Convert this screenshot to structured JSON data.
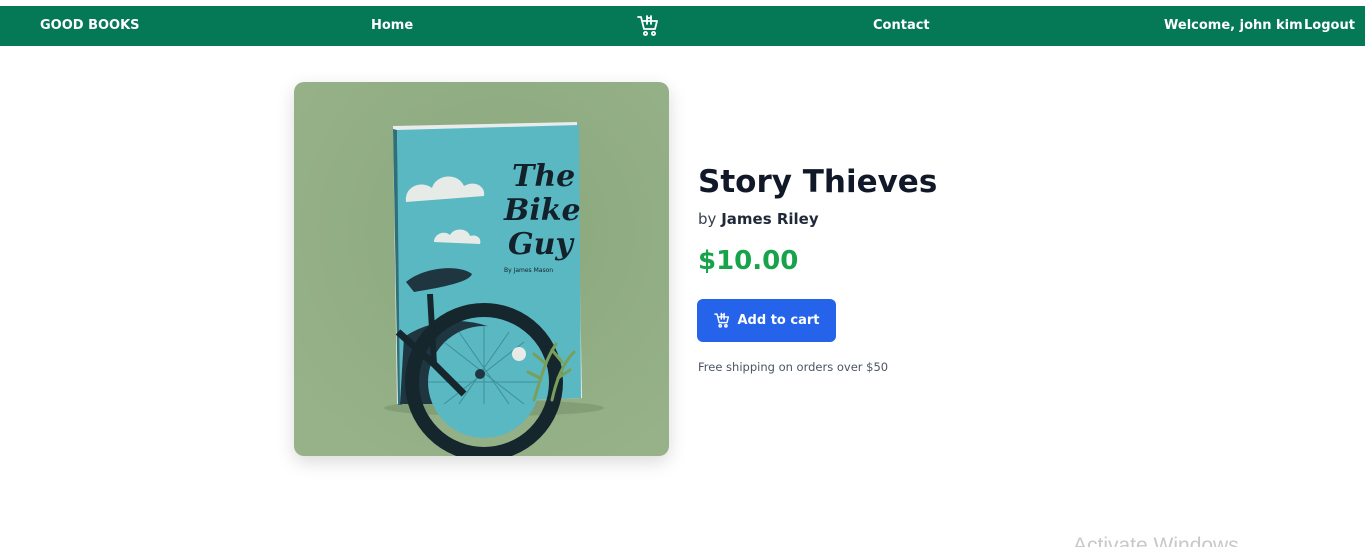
{
  "nav": {
    "brand": "GOOD BOOKS",
    "home": "Home",
    "cart_icon": "cart-icon",
    "contact": "Contact",
    "welcome": "Welcome, john kim",
    "logout": "Logout"
  },
  "product": {
    "title": "Story Thieves",
    "by_prefix": "by",
    "author": "James Riley",
    "price": "$10.00",
    "add_to_cart_label": "Add to cart",
    "shipping_note": "Free shipping on orders over $50",
    "cover": {
      "line1": "The",
      "line2": "Bike",
      "line3": "Guy",
      "cover_author": "By James Mason"
    }
  },
  "os": {
    "watermark": "Activate Windows"
  },
  "colors": {
    "nav_bg": "#057855",
    "price": "#16a34a",
    "button": "#2563eb",
    "image_bg": "#93ae84",
    "book_cover": "#5ab8c3"
  }
}
